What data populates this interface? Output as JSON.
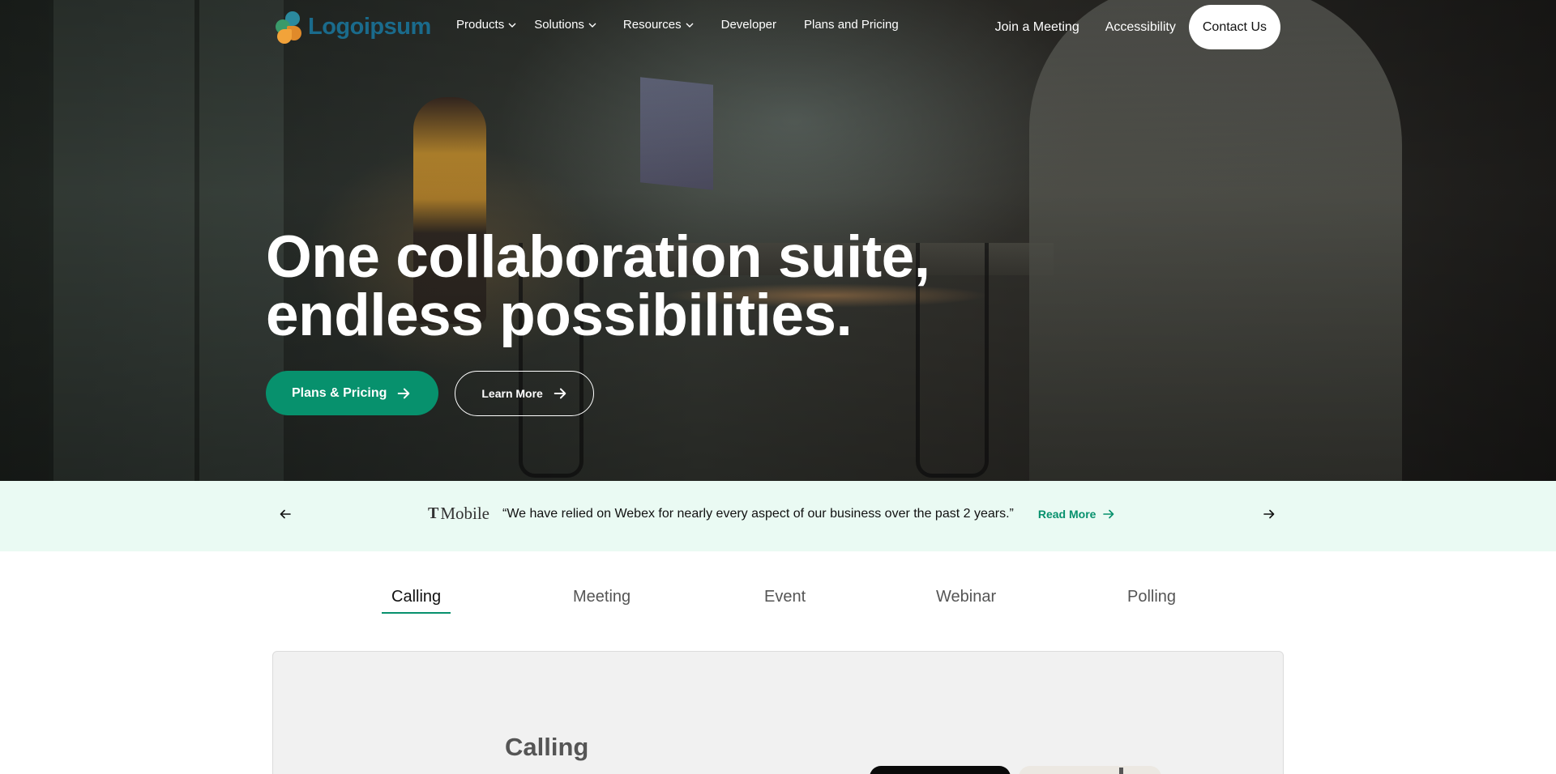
{
  "nav": {
    "logo_text": "Logoipsum",
    "links": [
      {
        "label": "Products",
        "dropdown": true
      },
      {
        "label": "Solutions",
        "dropdown": true
      },
      {
        "label": "Resources",
        "dropdown": true
      },
      {
        "label": "Developer",
        "dropdown": false
      },
      {
        "label": "Plans and Pricing",
        "dropdown": false
      }
    ],
    "right_links": [
      "Join a Meeting",
      "Accessibility"
    ],
    "contact_label": "Contact Us"
  },
  "hero": {
    "headline_line1": "One collaboration suite,",
    "headline_line2": "endless possibilities.",
    "primary_cta": "Plans & Pricing",
    "secondary_cta": "Learn More",
    "accent_color": "#07916d"
  },
  "testimonial": {
    "brand": "Mobile",
    "brand_glyph": "T",
    "quote": "“We have relied on Webex for nearly every aspect of our business over the past 2 years.”",
    "read_more": "Read More",
    "background_color": "#eafaf3"
  },
  "tabs": {
    "items": [
      "Calling",
      "Meeting",
      "Event",
      "Webinar",
      "Polling"
    ],
    "active": "Calling"
  },
  "panel": {
    "title": "Calling"
  },
  "icons": {
    "dropdown": "chevron-down-icon",
    "cta_arrow": "arrow-right-icon",
    "prev": "arrow-left-icon",
    "next": "arrow-right-icon"
  }
}
